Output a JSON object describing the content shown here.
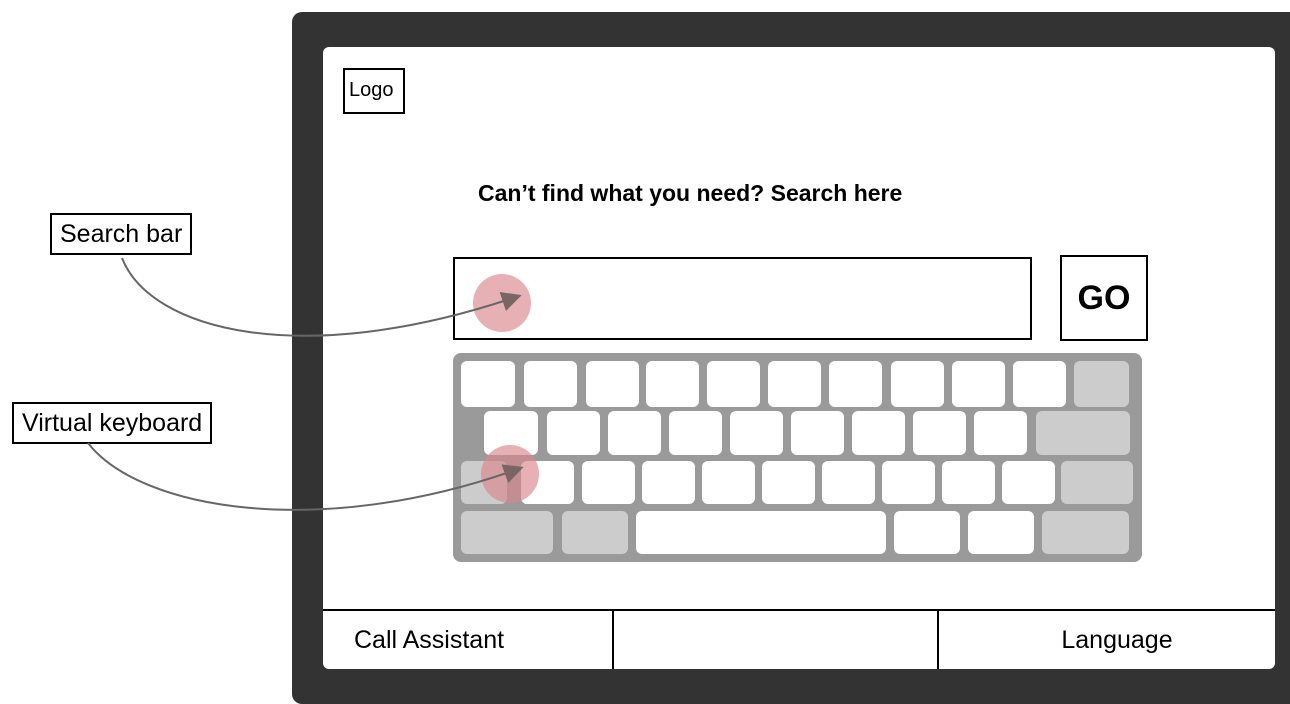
{
  "callouts": {
    "search_bar": "Search bar",
    "virtual_keyboard": "Virtual keyboard"
  },
  "screen": {
    "logo": "Logo",
    "headline": "Can’t find what you need? Search here",
    "search": {
      "value": "",
      "placeholder": ""
    },
    "go_label": "GO"
  },
  "footer": {
    "left": "Call Assistant",
    "middle": "",
    "right": "Language"
  },
  "colors": {
    "device_frame": "#333333",
    "keyboard_body": "#9a9a9a",
    "key": "#ffffff",
    "modifier_key": "#cccccc",
    "touch_marker": "#d9868c"
  }
}
